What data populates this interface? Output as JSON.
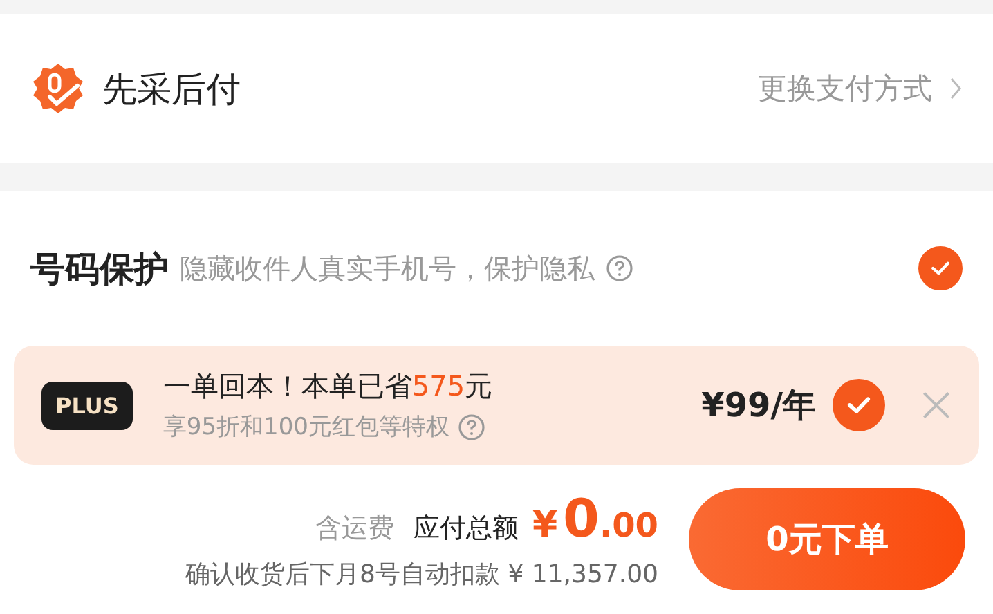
{
  "payment": {
    "title": "先采后付",
    "action": "更换支付方式"
  },
  "number_protection": {
    "title": "号码保护",
    "description": "隐藏收件人真实手机号，保护隐私",
    "checked": true
  },
  "plus_offer": {
    "badge": "PLUS",
    "headline": "一单回本！本单已省**575**元",
    "subline": "享95折和100元红包等特权",
    "price": "¥99/年",
    "checked": true
  },
  "footer": {
    "shipping_note": "含运费",
    "total_label": "应付总额",
    "currency": "¥",
    "amount_integer": "0",
    "amount_decimal": ".00",
    "deferred_note": "确认收货后下月8号自动扣款 ¥ 11,357.00",
    "submit": "0元下单"
  }
}
